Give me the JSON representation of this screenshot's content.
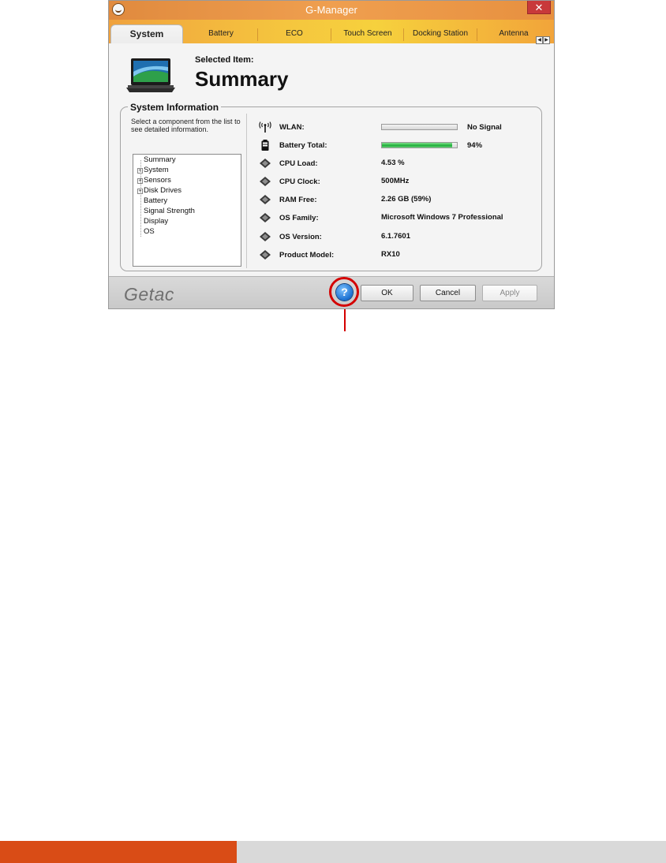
{
  "window": {
    "title": "G-Manager",
    "close_glyph": "✕"
  },
  "tabs": [
    {
      "label": "System",
      "active": true
    },
    {
      "label": "Battery"
    },
    {
      "label": "ECO"
    },
    {
      "label": "Touch Screen"
    },
    {
      "label": "Docking Station"
    },
    {
      "label": "Antenna"
    }
  ],
  "tab_scroll": {
    "left": "◀",
    "right": "▶"
  },
  "header": {
    "selected_label": "Selected Item:",
    "selected_value": "Summary",
    "icon": "laptop-icon"
  },
  "system_info": {
    "group_title": "System Information",
    "hint": "Select a component from the list to see detailed information.",
    "tree": [
      {
        "label": "Summary",
        "expandable": false
      },
      {
        "label": "System",
        "expandable": true
      },
      {
        "label": "Sensors",
        "expandable": true
      },
      {
        "label": "Disk Drives",
        "expandable": true
      },
      {
        "label": "Battery",
        "expandable": false
      },
      {
        "label": "Signal Strength",
        "expandable": false
      },
      {
        "label": "Display",
        "expandable": false
      },
      {
        "label": "OS",
        "expandable": false
      }
    ],
    "rows": [
      {
        "icon": "antenna-icon",
        "label": "WLAN:",
        "value": "No Signal",
        "bar_fraction": 0
      },
      {
        "icon": "battery-icon",
        "label": "Battery Total:",
        "value": "94%",
        "bar_fraction": 0.94
      },
      {
        "icon": "chip-icon",
        "label": "CPU Load:",
        "value": "4.53 %"
      },
      {
        "icon": "chip-icon",
        "label": "CPU Clock:",
        "value": "500MHz"
      },
      {
        "icon": "chip-icon",
        "label": "RAM Free:",
        "value": "2.26 GB (59%)"
      },
      {
        "icon": "chip-icon",
        "label": "OS Family:",
        "value": "Microsoft Windows 7 Professional"
      },
      {
        "icon": "chip-icon",
        "label": "OS Version:",
        "value": "6.1.7601"
      },
      {
        "icon": "chip-icon",
        "label": "Product Model:",
        "value": "RX10"
      }
    ]
  },
  "footer": {
    "logo": "Getac",
    "help_glyph": "?",
    "ok_label": "OK",
    "cancel_label": "Cancel",
    "apply_label": "Apply"
  },
  "colors": {
    "accent_orange": "#d94c16",
    "callout_red": "#d40000",
    "progress_green": "#1fae3a"
  }
}
